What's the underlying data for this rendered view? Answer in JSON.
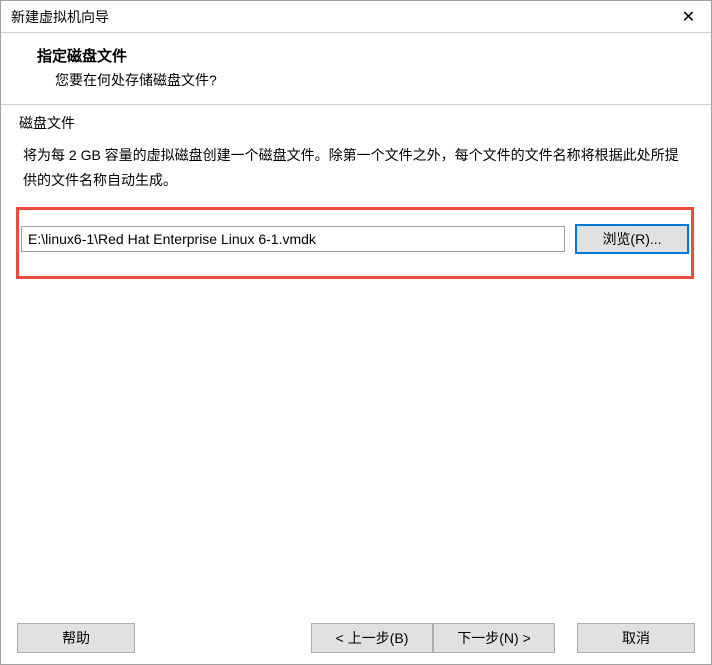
{
  "window": {
    "title": "新建虚拟机向导"
  },
  "header": {
    "title": "指定磁盘文件",
    "subtitle": "您要在何处存储磁盘文件?"
  },
  "content": {
    "fieldset_label": "磁盘文件",
    "description": "将为每 2 GB 容量的虚拟磁盘创建一个磁盘文件。除第一个文件之外，每个文件的文件名称将根据此处所提供的文件名称自动生成。",
    "file_path": "E:\\linux6-1\\Red Hat Enterprise Linux 6-1.vmdk",
    "browse_label": "浏览(R)..."
  },
  "footer": {
    "help_label": "帮助",
    "back_label": "< 上一步(B)",
    "next_label": "下一步(N) >",
    "cancel_label": "取消"
  }
}
